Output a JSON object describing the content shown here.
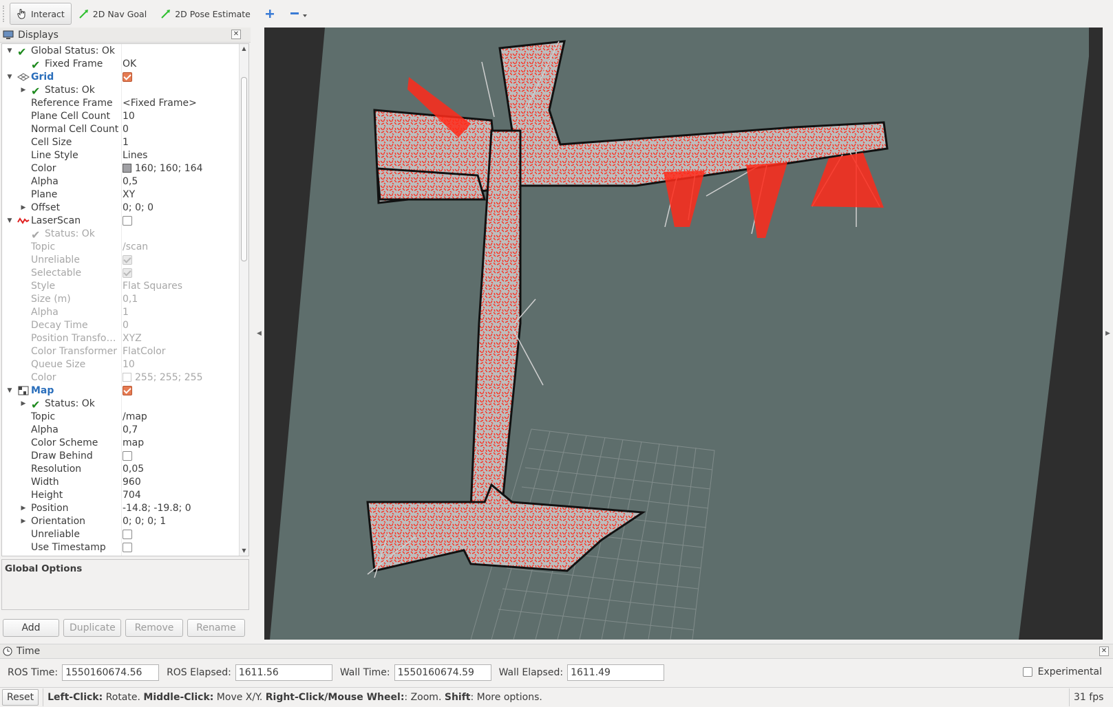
{
  "toolbar": {
    "tools": [
      {
        "label": "Interact",
        "icon": "hand-pointer-icon",
        "active": true
      },
      {
        "label": "2D Nav Goal",
        "icon": "green-arrow-icon"
      },
      {
        "label": "2D Pose Estimate",
        "icon": "green-arrow-icon"
      }
    ]
  },
  "displays": {
    "title": "Displays",
    "rows": [
      {
        "label": "Global Status: Ok",
        "value": ""
      },
      {
        "label": "Fixed Frame",
        "value": "OK"
      },
      {
        "label": "Grid",
        "value": ""
      },
      {
        "label": "Status: Ok",
        "value": ""
      },
      {
        "label": "Reference Frame",
        "value": "<Fixed Frame>"
      },
      {
        "label": "Plane Cell Count",
        "value": "10"
      },
      {
        "label": "Normal Cell Count",
        "value": "0"
      },
      {
        "label": "Cell Size",
        "value": "1"
      },
      {
        "label": "Line Style",
        "value": "Lines"
      },
      {
        "label": "Color",
        "value": "160; 160; 164",
        "swatch": "#a0a0a4"
      },
      {
        "label": "Alpha",
        "value": "0,5"
      },
      {
        "label": "Plane",
        "value": "XY"
      },
      {
        "label": "Offset",
        "value": "0; 0; 0"
      },
      {
        "label": "LaserScan",
        "value": ""
      },
      {
        "label": "Status: Ok",
        "value": ""
      },
      {
        "label": "Topic",
        "value": "/scan"
      },
      {
        "label": "Unreliable",
        "value": ""
      },
      {
        "label": "Selectable",
        "value": ""
      },
      {
        "label": "Style",
        "value": "Flat Squares"
      },
      {
        "label": "Size (m)",
        "value": "0,1"
      },
      {
        "label": "Alpha",
        "value": "1"
      },
      {
        "label": "Decay Time",
        "value": "0"
      },
      {
        "label": "Position Transfo…",
        "value": "XYZ"
      },
      {
        "label": "Color Transformer",
        "value": "FlatColor"
      },
      {
        "label": "Queue Size",
        "value": "10"
      },
      {
        "label": "Color",
        "value": "255; 255; 255",
        "swatch": "#ffffff"
      },
      {
        "label": "Map",
        "value": ""
      },
      {
        "label": "Status: Ok",
        "value": ""
      },
      {
        "label": "Topic",
        "value": "/map"
      },
      {
        "label": "Alpha",
        "value": "0,7"
      },
      {
        "label": "Color Scheme",
        "value": "map"
      },
      {
        "label": "Draw Behind",
        "value": ""
      },
      {
        "label": "Resolution",
        "value": "0,05"
      },
      {
        "label": "Width",
        "value": "960"
      },
      {
        "label": "Height",
        "value": "704"
      },
      {
        "label": "Position",
        "value": "-14.8; -19.8; 0"
      },
      {
        "label": "Orientation",
        "value": "0; 0; 0; 1"
      },
      {
        "label": "Unreliable",
        "value": ""
      },
      {
        "label": "Use Timestamp",
        "value": ""
      }
    ]
  },
  "global_options": {
    "title": "Global Options"
  },
  "buttons": {
    "add": "Add",
    "duplicate": "Duplicate",
    "remove": "Remove",
    "rename": "Rename"
  },
  "time": {
    "title": "Time",
    "ros_time_label": "ROS Time:",
    "ros_time": "1550160674.56",
    "ros_elapsed_label": "ROS Elapsed:",
    "ros_elapsed": "1611.56",
    "wall_time_label": "Wall Time:",
    "wall_time": "1550160674.59",
    "wall_elapsed_label": "Wall Elapsed:",
    "wall_elapsed": "1611.49",
    "experimental_label": "Experimental"
  },
  "status": {
    "reset": "Reset",
    "h1": "Left-Click:",
    "t1": " Rotate. ",
    "h2": "Middle-Click:",
    "t2": " Move X/Y. ",
    "h3": "Right-Click/Mouse Wheel:",
    "t3": ": Zoom. ",
    "h4": "Shift",
    "t4": ": More options.",
    "fps": "31 fps"
  },
  "colors": {
    "map_floor": "#5e6e6c",
    "free_space": "#bdbdbd",
    "laser": "#ff2a1a",
    "grid": "#a0a0a4"
  }
}
